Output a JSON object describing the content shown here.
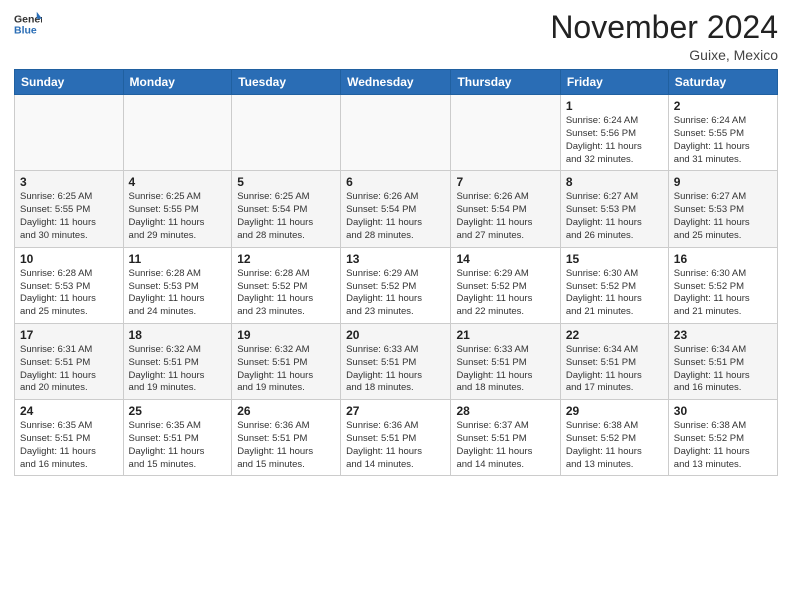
{
  "header": {
    "logo_line1": "General",
    "logo_line2": "Blue",
    "month": "November 2024",
    "location": "Guixe, Mexico"
  },
  "weekdays": [
    "Sunday",
    "Monday",
    "Tuesday",
    "Wednesday",
    "Thursday",
    "Friday",
    "Saturday"
  ],
  "weeks": [
    [
      {
        "day": "",
        "info": ""
      },
      {
        "day": "",
        "info": ""
      },
      {
        "day": "",
        "info": ""
      },
      {
        "day": "",
        "info": ""
      },
      {
        "day": "",
        "info": ""
      },
      {
        "day": "1",
        "info": "Sunrise: 6:24 AM\nSunset: 5:56 PM\nDaylight: 11 hours\nand 32 minutes."
      },
      {
        "day": "2",
        "info": "Sunrise: 6:24 AM\nSunset: 5:55 PM\nDaylight: 11 hours\nand 31 minutes."
      }
    ],
    [
      {
        "day": "3",
        "info": "Sunrise: 6:25 AM\nSunset: 5:55 PM\nDaylight: 11 hours\nand 30 minutes."
      },
      {
        "day": "4",
        "info": "Sunrise: 6:25 AM\nSunset: 5:55 PM\nDaylight: 11 hours\nand 29 minutes."
      },
      {
        "day": "5",
        "info": "Sunrise: 6:25 AM\nSunset: 5:54 PM\nDaylight: 11 hours\nand 28 minutes."
      },
      {
        "day": "6",
        "info": "Sunrise: 6:26 AM\nSunset: 5:54 PM\nDaylight: 11 hours\nand 28 minutes."
      },
      {
        "day": "7",
        "info": "Sunrise: 6:26 AM\nSunset: 5:54 PM\nDaylight: 11 hours\nand 27 minutes."
      },
      {
        "day": "8",
        "info": "Sunrise: 6:27 AM\nSunset: 5:53 PM\nDaylight: 11 hours\nand 26 minutes."
      },
      {
        "day": "9",
        "info": "Sunrise: 6:27 AM\nSunset: 5:53 PM\nDaylight: 11 hours\nand 25 minutes."
      }
    ],
    [
      {
        "day": "10",
        "info": "Sunrise: 6:28 AM\nSunset: 5:53 PM\nDaylight: 11 hours\nand 25 minutes."
      },
      {
        "day": "11",
        "info": "Sunrise: 6:28 AM\nSunset: 5:53 PM\nDaylight: 11 hours\nand 24 minutes."
      },
      {
        "day": "12",
        "info": "Sunrise: 6:28 AM\nSunset: 5:52 PM\nDaylight: 11 hours\nand 23 minutes."
      },
      {
        "day": "13",
        "info": "Sunrise: 6:29 AM\nSunset: 5:52 PM\nDaylight: 11 hours\nand 23 minutes."
      },
      {
        "day": "14",
        "info": "Sunrise: 6:29 AM\nSunset: 5:52 PM\nDaylight: 11 hours\nand 22 minutes."
      },
      {
        "day": "15",
        "info": "Sunrise: 6:30 AM\nSunset: 5:52 PM\nDaylight: 11 hours\nand 21 minutes."
      },
      {
        "day": "16",
        "info": "Sunrise: 6:30 AM\nSunset: 5:52 PM\nDaylight: 11 hours\nand 21 minutes."
      }
    ],
    [
      {
        "day": "17",
        "info": "Sunrise: 6:31 AM\nSunset: 5:51 PM\nDaylight: 11 hours\nand 20 minutes."
      },
      {
        "day": "18",
        "info": "Sunrise: 6:32 AM\nSunset: 5:51 PM\nDaylight: 11 hours\nand 19 minutes."
      },
      {
        "day": "19",
        "info": "Sunrise: 6:32 AM\nSunset: 5:51 PM\nDaylight: 11 hours\nand 19 minutes."
      },
      {
        "day": "20",
        "info": "Sunrise: 6:33 AM\nSunset: 5:51 PM\nDaylight: 11 hours\nand 18 minutes."
      },
      {
        "day": "21",
        "info": "Sunrise: 6:33 AM\nSunset: 5:51 PM\nDaylight: 11 hours\nand 18 minutes."
      },
      {
        "day": "22",
        "info": "Sunrise: 6:34 AM\nSunset: 5:51 PM\nDaylight: 11 hours\nand 17 minutes."
      },
      {
        "day": "23",
        "info": "Sunrise: 6:34 AM\nSunset: 5:51 PM\nDaylight: 11 hours\nand 16 minutes."
      }
    ],
    [
      {
        "day": "24",
        "info": "Sunrise: 6:35 AM\nSunset: 5:51 PM\nDaylight: 11 hours\nand 16 minutes."
      },
      {
        "day": "25",
        "info": "Sunrise: 6:35 AM\nSunset: 5:51 PM\nDaylight: 11 hours\nand 15 minutes."
      },
      {
        "day": "26",
        "info": "Sunrise: 6:36 AM\nSunset: 5:51 PM\nDaylight: 11 hours\nand 15 minutes."
      },
      {
        "day": "27",
        "info": "Sunrise: 6:36 AM\nSunset: 5:51 PM\nDaylight: 11 hours\nand 14 minutes."
      },
      {
        "day": "28",
        "info": "Sunrise: 6:37 AM\nSunset: 5:51 PM\nDaylight: 11 hours\nand 14 minutes."
      },
      {
        "day": "29",
        "info": "Sunrise: 6:38 AM\nSunset: 5:52 PM\nDaylight: 11 hours\nand 13 minutes."
      },
      {
        "day": "30",
        "info": "Sunrise: 6:38 AM\nSunset: 5:52 PM\nDaylight: 11 hours\nand 13 minutes."
      }
    ]
  ]
}
